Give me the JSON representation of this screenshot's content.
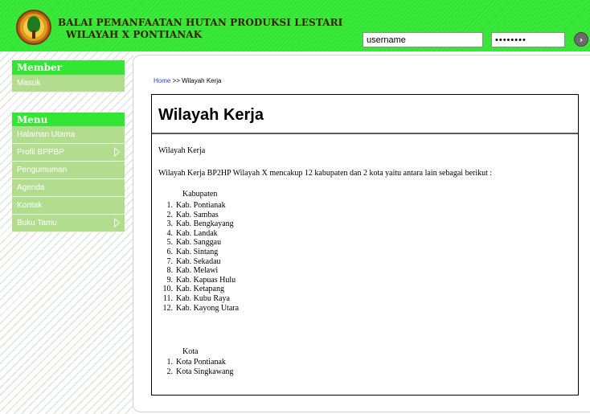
{
  "header": {
    "title_line1": "BALAI PEMANFAATAN HUTAN PRODUKSI LESTARI",
    "title_line2": "WILAYAH X PONTIANAK",
    "username_value": "username",
    "password_value": "••••••••",
    "go_icon": "arrow-right-circle-icon"
  },
  "sidebar": {
    "member_heading": "Member",
    "member_items": [
      {
        "label": "Masuk"
      }
    ],
    "menu_heading": "Menu",
    "menu_items": [
      {
        "label": "Halaman Utama",
        "has_submenu": false
      },
      {
        "label": "Profil BPPBP",
        "has_submenu": true
      },
      {
        "label": "Pengumuman",
        "has_submenu": false
      },
      {
        "label": "Agenda",
        "has_submenu": false
      },
      {
        "label": "Kontak",
        "has_submenu": false
      },
      {
        "label": "Buku Tamu",
        "has_submenu": true
      }
    ]
  },
  "breadcrumb": {
    "home": "Home",
    "separator": ">>",
    "current": "Wilayah Kerja"
  },
  "content": {
    "title": "Wilayah Kerja",
    "subheading": "Wilayah Kerja",
    "intro": "Wilayah Kerja BP2HP Wilayah X mencakup 12 kabupaten dan 2 kota yaitu antara lain sebagai berikut :",
    "kabupaten_heading": "Kabupaten",
    "kabupaten": [
      "Kab. Pontianak",
      "Kab. Sambas",
      "Kab. Bengkayang",
      "Kab. Landak",
      "Kab. Sanggau",
      "Kab. Sintang",
      "Kab. Sekadau",
      "Kab. Melawi",
      "Kab. Kapuas Hulu",
      "Kab. Ketapang",
      "Kab. Kubu Raya",
      "Kab. Kayong Utara"
    ],
    "kota_heading": "Kota",
    "kota": [
      "Kota Pontianak",
      "Kota Singkawang"
    ]
  },
  "colors": {
    "brand_green": "#33e633",
    "sidebar_item_green": "#b2dd8f",
    "link_blue": "#2a3fbf"
  }
}
